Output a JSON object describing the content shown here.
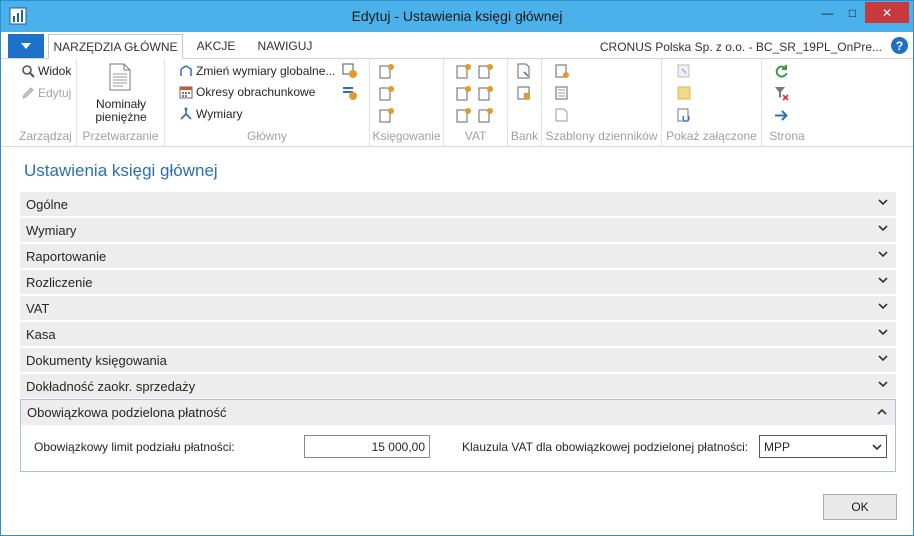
{
  "window": {
    "title": "Edytuj - Ustawienia księgi głównej",
    "min_glyph": "—",
    "max_glyph": "□",
    "close_glyph": "✕"
  },
  "tabs": [
    {
      "label": "NARZĘDZIA GŁÓWNE",
      "active": true
    },
    {
      "label": "AKCJE",
      "active": false
    },
    {
      "label": "NAWIGUJ",
      "active": false
    }
  ],
  "company": "CRONUS Polska Sp. z o.o. - BC_SR_19PL_OnPre...",
  "help_glyph": "?",
  "ribbon": {
    "groups": {
      "manage": "Zarządzaj",
      "process": "Przetwarzanie",
      "main": "Główny",
      "posting": "Księgowanie",
      "vat": "VAT",
      "bank": "Bank",
      "journal_templates": "Szablony dzienników",
      "attachments": "Pokaż załączone",
      "page": "Strona"
    },
    "view": "Widok",
    "edit": "Edytuj",
    "denominations_line1": "Nominały",
    "denominations_line2": "pieniężne",
    "change_dimensions": "Zmień wymiary globalne...",
    "accounting_periods": "Okresy obrachunkowe",
    "dimensions": "Wymiary"
  },
  "page_title": "Ustawienia księgi głównej",
  "fasttabs": [
    "Ogólne",
    "Wymiary",
    "Raportowanie",
    "Rozliczenie",
    "VAT",
    "Kasa",
    "Dokumenty księgowania",
    "Dokładność zaokr. sprzedaży"
  ],
  "expanded_tab": {
    "title": "Obowiązkowa podzielona płatność",
    "limit_label": "Obowiązkowy limit podziału płatności:",
    "limit_value": "15 000,00",
    "vat_clause_label": "Klauzula VAT dla obowiązkowej podzielonej płatności:",
    "vat_clause_value": "MPP"
  },
  "ok_label": "OK",
  "colors": {
    "titlebar": "#4bb1eb",
    "accent": "#1e71c9",
    "page_title": "#2c6fb1",
    "close": "#c7393b"
  }
}
